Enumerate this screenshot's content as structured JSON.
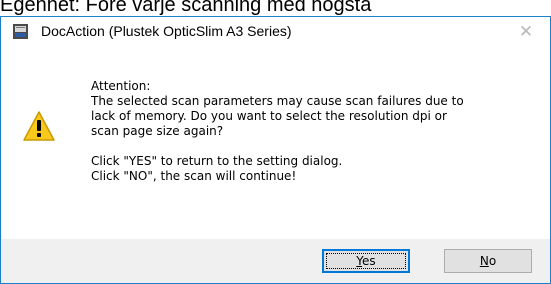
{
  "background": {
    "text": "Egenhet: Före varje scanning med högsta"
  },
  "window": {
    "title": "DocAction (Plustek OpticSlim A3 Series)",
    "close_glyph": "✕"
  },
  "message": {
    "lines": [
      "Attention:",
      "The selected scan parameters may cause scan failures due to",
      "lack of memory. Do you want to select the resolution dpi or",
      "scan page size again?",
      "",
      "Click \"YES\" to return to the setting dialog.",
      "Click \"NO\", the scan will continue!"
    ]
  },
  "buttons": {
    "yes": {
      "mnemonic": "Y",
      "rest": "es"
    },
    "no": {
      "mnemonic": "N",
      "rest": "o"
    }
  },
  "icons": {
    "app": "scanner-app-icon",
    "warning": "warning-icon",
    "close": "close-icon"
  },
  "colors": {
    "window_border": "#1a80c8",
    "footer_bg": "#f0f0f0",
    "button_bg": "#e1e1e1",
    "default_button_border": "#0078d7",
    "warning_yellow": "#f8c81c"
  }
}
